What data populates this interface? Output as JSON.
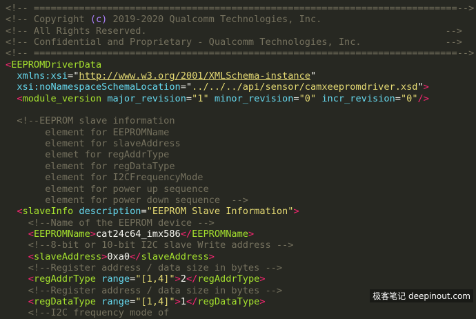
{
  "header": {
    "rule_left": "<!-- =========================================================================",
    "rule_right": "==-->",
    "copyright_pre": "<!-- Copyright ",
    "copyright_c": "(c)",
    "copyright_post": " 2019-2020 Qualcomm Technologies, Inc.",
    "rights": "<!-- All Rights Reserved.",
    "rights_end": "-->",
    "confidential": "<!-- Confidential and Proprietary - Qualcomm Technologies, Inc.",
    "confidential_end": "-->",
    "rule2_left": "<!-- =========================================================================",
    "rule2_right": "==-->"
  },
  "root": {
    "open_lt": "<",
    "name": "EEPROMDriverData",
    "xmlns_attr": "xmlns:xsi",
    "eq": "=\"",
    "xmlns_val": "http://www.w3.org/2001/XMLSchema-instance",
    "q": "\"",
    "schema_attr": "xsi:noNamespaceSchemaLocation",
    "schema_val": "../../../api/sensor/camxeepromdriver.xsd",
    "close_gt": ">"
  },
  "module_version": {
    "lt": "<",
    "tag": "module_version",
    "major_attr": "major_revision",
    "major_val": "\"1\"",
    "minor_attr": "minor_revision",
    "minor_val": "\"0\"",
    "incr_attr": "incr_revision",
    "incr_val": "\"0\"",
    "end": "/>"
  },
  "slave_comment": [
    "<!--EEPROM slave information",
    "     element for EEPROMName",
    "     element for slaveAddress",
    "     elemet for regAddrType",
    "     element for regDataType",
    "     element for I2CFrequencyMode",
    "     element for power up sequence",
    "     element for power down sequence  -->"
  ],
  "slave_info": {
    "lt": "<",
    "tag": "slaveInfo",
    "desc_attr": "description",
    "desc_val": "\"EEPROM Slave Information\"",
    "gt": ">"
  },
  "eeprom_name_comment": "<!--Name of the EEPROM device -->",
  "eeprom_name": {
    "tag": "EEPROMName",
    "value": "cat24c64_imx586"
  },
  "slave_addr_comment": "<!--8-bit or 10-bit I2C slave Write address -->",
  "slave_addr": {
    "tag": "slaveAddress",
    "value": "0xa0"
  },
  "reg_comment_1": "<!--Register address / data size in bytes -->",
  "reg_addr": {
    "tag": "regAddrType",
    "range_attr": "range",
    "range_val": "\"[1,4]\"",
    "value": "2"
  },
  "reg_comment_2": "<!--Register address / data size in bytes -->",
  "reg_data": {
    "tag": "regDataType",
    "range_attr": "range",
    "range_val": "\"[1,4]\"",
    "value": "1"
  },
  "partial_line": "<!--I2C frequency mode of",
  "watermark": "极客笔记 deepinout.com"
}
